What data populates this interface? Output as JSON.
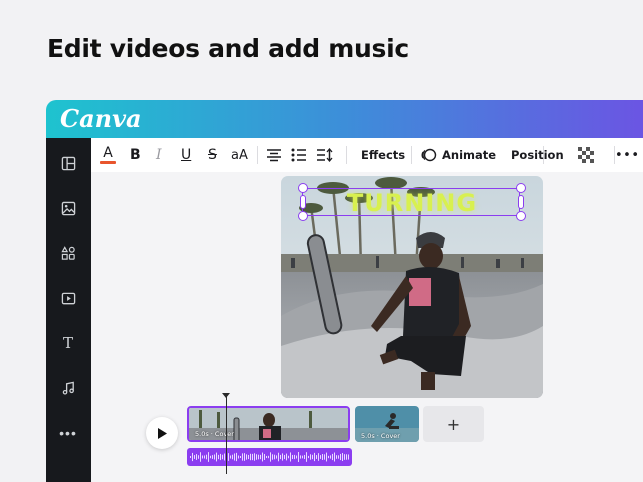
{
  "promo": {
    "title": "Edit videos and add music"
  },
  "brand": {
    "logo_text": "Canva",
    "gradient": [
      "#1ec3cf",
      "#3d8ed9",
      "#6b55e3"
    ]
  },
  "sidebar": {
    "items": [
      {
        "name": "layout-icon"
      },
      {
        "name": "image-icon"
      },
      {
        "name": "elements-icon"
      },
      {
        "name": "video-icon"
      },
      {
        "name": "text-icon",
        "glyph": "T"
      },
      {
        "name": "music-icon"
      },
      {
        "name": "more-icon",
        "glyph": "•••"
      }
    ]
  },
  "toolbar": {
    "text_color_glyph": "A",
    "text_color": "#e8552d",
    "bold": "B",
    "italic": "I",
    "underline": "U",
    "strikethrough": "S",
    "case": "aA",
    "effects": "Effects",
    "animate": "Animate",
    "position": "Position",
    "more": "•••"
  },
  "canvas": {
    "headline_text": "TURNING",
    "headline_color": "#d8f04f",
    "selection_color": "#8b3df0"
  },
  "timeline": {
    "clips": [
      {
        "label": "5.0s · Cover",
        "selected": true
      },
      {
        "label": "5.0s · Cover",
        "selected": false
      }
    ],
    "add_label": "+",
    "audio_color": "#8b3df0"
  }
}
